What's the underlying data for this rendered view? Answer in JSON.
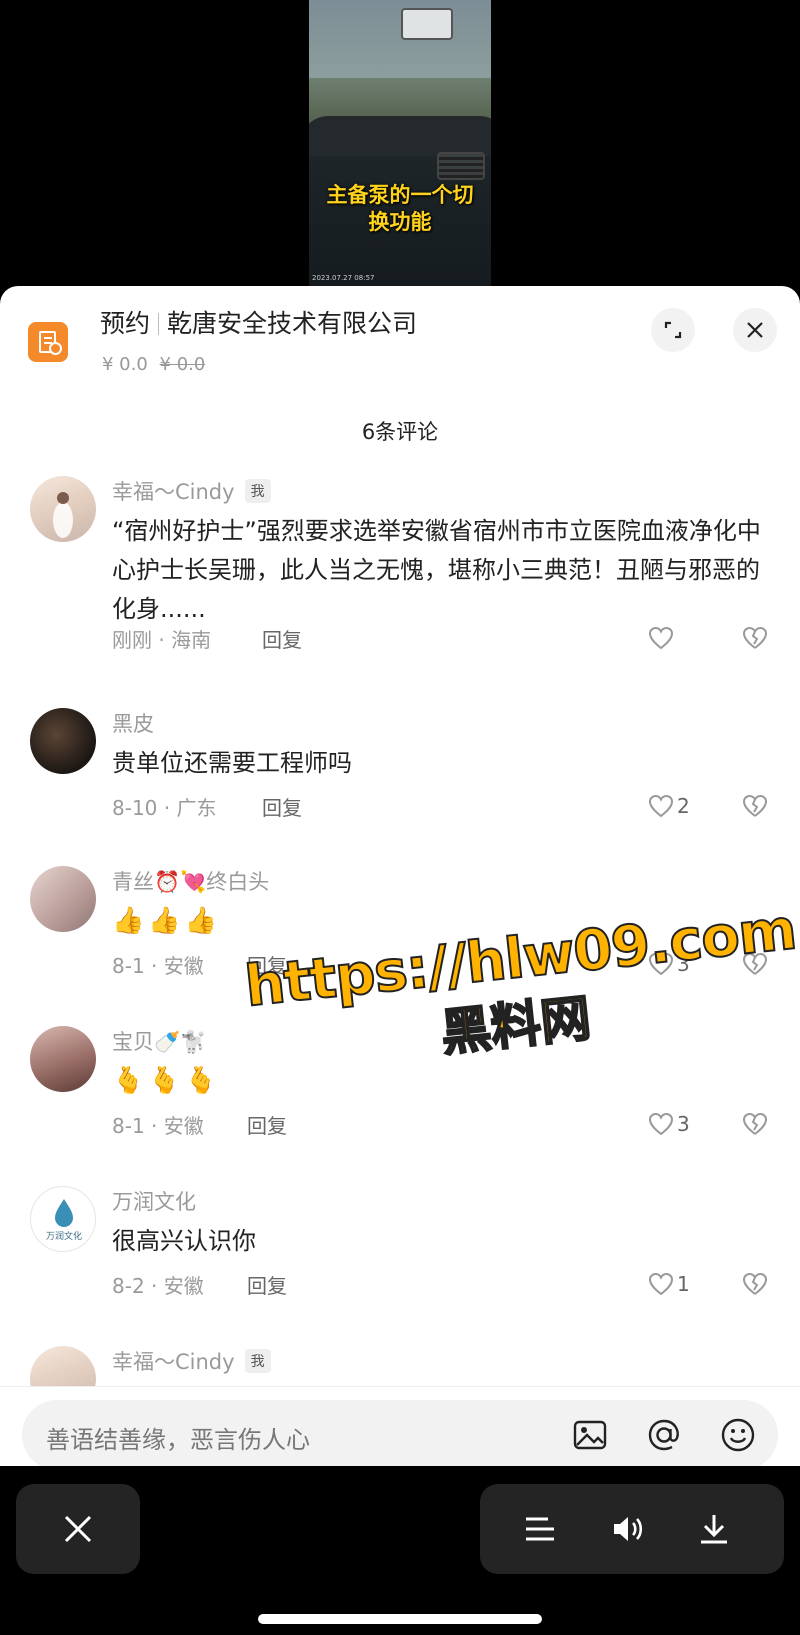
{
  "video": {
    "subtitle_line1": "主备泵的一个切",
    "subtitle_line2": "换功能",
    "timestamp": "2023.07.27 08:57"
  },
  "header": {
    "tag": "预约",
    "company": "乾唐安全技术有限公司",
    "price": "¥ 0.0",
    "original_price": "¥ 0.0",
    "accent_color": "#f58a2a"
  },
  "comments_header": "6条评论",
  "comments": [
    {
      "name": "幸福～Cindy",
      "badge": "我",
      "text": "“宿州好护士”强烈要求选举安徽省宿州市市立医院血液净化中心护士长吴珊，此人当之无愧，堪称小三典范！丑陋与邪恶的化身......",
      "meta": "刚刚 · 海南",
      "reply": "回复",
      "likes": ""
    },
    {
      "name": "黑皮",
      "text": "贵单位还需要工程师吗",
      "meta": "8-10 · 广东",
      "reply": "回复",
      "likes": "2"
    },
    {
      "name": "青丝⏰💘终白头",
      "text": "👍👍👍",
      "meta": "8-1 · 安徽",
      "reply": "回复",
      "likes": "3"
    },
    {
      "name": "宝贝🍼🐩",
      "text": "🫰🫰🫰",
      "meta": "8-1 · 安徽",
      "reply": "回复",
      "likes": "3"
    },
    {
      "name": "万润文化",
      "text": "很高兴认识你",
      "meta": "8-2 · 安徽",
      "reply": "回复",
      "likes": "1"
    },
    {
      "name": "幸福～Cindy",
      "badge": "我"
    }
  ],
  "input": {
    "placeholder": "善语结善缘，恶言伤人心"
  },
  "watermark": {
    "url": "https://hlw09.com",
    "name": "黑料网"
  },
  "icons": {
    "image": "image-icon",
    "at": "at-icon",
    "emoji": "emoji-icon",
    "like": "heart-icon",
    "dislike": "broken-heart-icon"
  }
}
